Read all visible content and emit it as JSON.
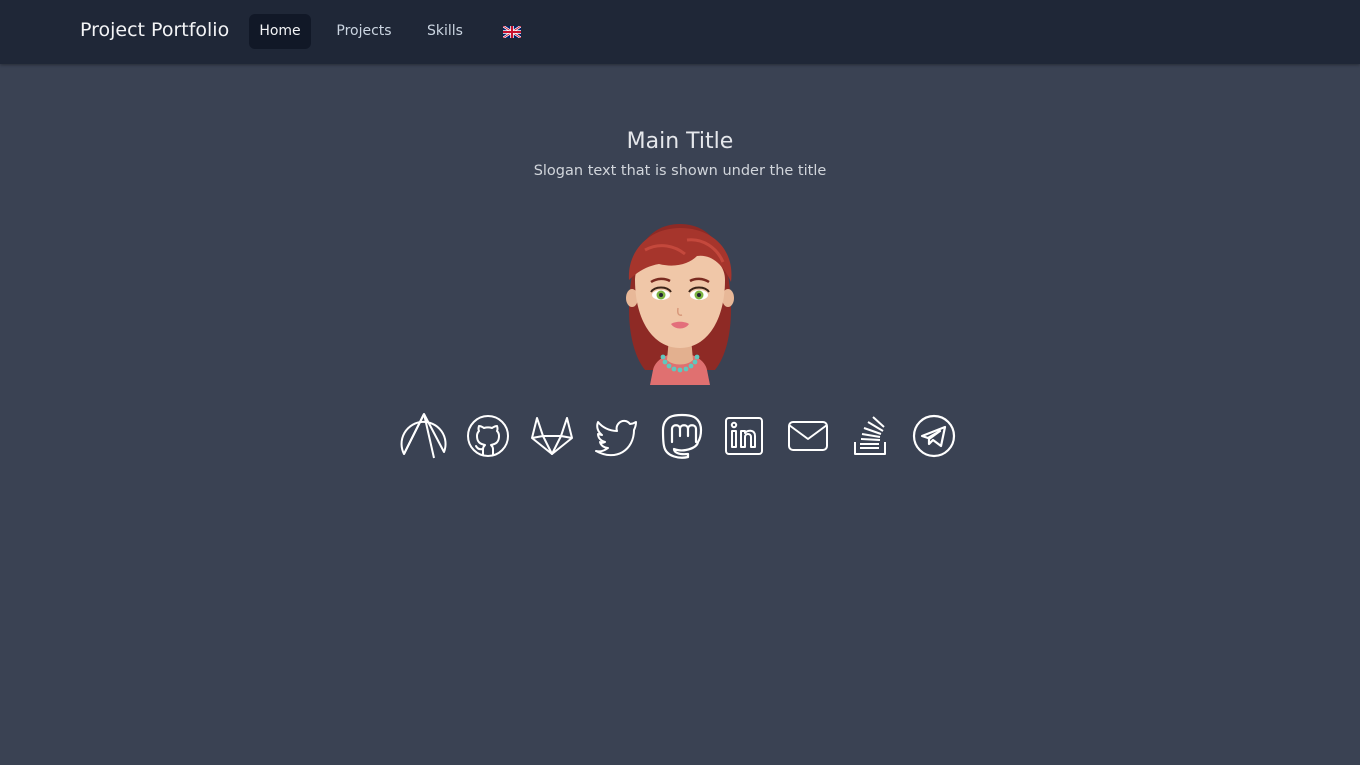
{
  "navbar": {
    "brand": "Project Portfolio",
    "links": [
      {
        "label": "Home",
        "active": true
      },
      {
        "label": "Projects",
        "active": false
      },
      {
        "label": "Skills",
        "active": false
      }
    ],
    "language": {
      "icon": "uk-flag-icon"
    }
  },
  "hero": {
    "title": "Main Title",
    "slogan": "Slogan text that is shown under the title",
    "avatar": {
      "icon": "avatar-woman-red-hair"
    }
  },
  "social_links": [
    {
      "icon": "codeberg-icon"
    },
    {
      "icon": "github-icon"
    },
    {
      "icon": "gitlab-icon"
    },
    {
      "icon": "twitter-icon"
    },
    {
      "icon": "mastodon-icon"
    },
    {
      "icon": "linkedin-icon"
    },
    {
      "icon": "email-icon"
    },
    {
      "icon": "stackoverflow-icon"
    },
    {
      "icon": "telegram-icon"
    }
  ],
  "colors": {
    "navbar_bg": "#1f2737",
    "page_bg": "#3a4253",
    "active_link_bg": "#111827",
    "text": "#e5e7eb"
  }
}
